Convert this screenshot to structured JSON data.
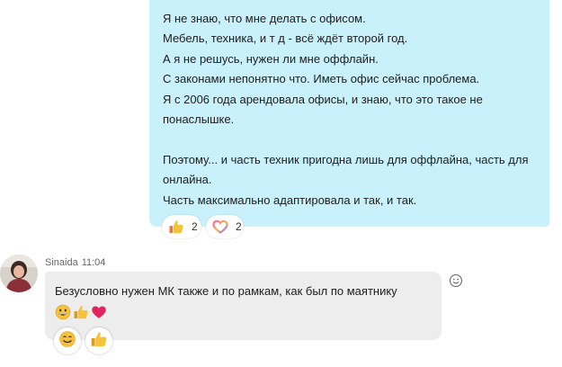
{
  "outgoing": {
    "lines": [
      "Я не знаю, что мне делать с офисом.",
      "Мебель, техника, и т д - всё ждёт второй год.",
      "А я не решусь, нужен ли мне оффлайн.",
      "С законами непонятно что. Иметь офис сейчас проблема.",
      "Я с 2006 года арендовала офисы, и знаю, что это такое  не",
      "понаслышке.",
      "",
      "Поэтому... и часть техник пригодна лишь для оффлайна, часть для",
      "онлайна.",
      "Часть максимально адаптировала и так, и так."
    ],
    "reactions": [
      {
        "icon": "thumbs-up-icon",
        "count": "2"
      },
      {
        "icon": "heart-icon",
        "count": "2"
      }
    ]
  },
  "incoming": {
    "sender": "Sinaida",
    "time": "11:04",
    "text": "Безусловно нужен МК также и по рамкам, как был по маятнику",
    "emojis": [
      "grinning-face-icon",
      "thumbs-up-icon",
      "red-heart-icon"
    ],
    "reactions": [
      "smiling-face-icon",
      "thumbs-up-icon"
    ]
  },
  "colors": {
    "outgoing_bubble": "#c9f1fb",
    "incoming_bubble": "#ededed",
    "heart": "#e0245e",
    "emoji_yellow": "#f5c33b"
  }
}
